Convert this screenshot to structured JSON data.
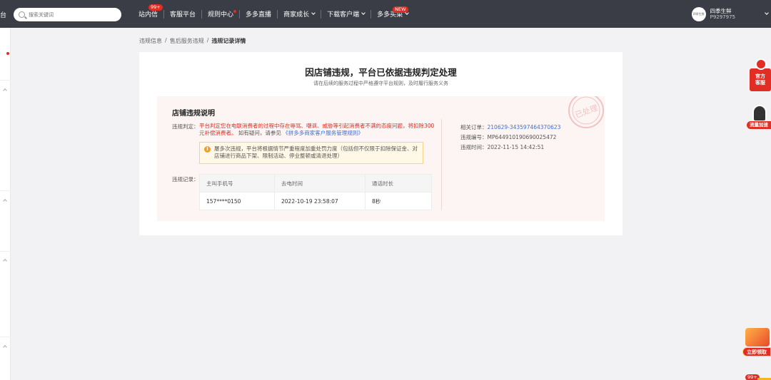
{
  "topbar": {
    "left_cut_text": "台",
    "search_placeholder": "搜索关键词",
    "nav": [
      {
        "label": "站内信",
        "badge": "99+"
      },
      {
        "label": "客服平台"
      },
      {
        "label": "规则中心",
        "dot": true
      },
      {
        "label": "多多直播"
      },
      {
        "label": "商家成长",
        "dropdown": true
      },
      {
        "label": "下载客户端",
        "dropdown": true
      },
      {
        "label": "多多买菜",
        "badge": "NEW",
        "dropdown": true
      }
    ],
    "user": {
      "avatar_text": "四季生鲜",
      "name": "四季生鲜",
      "id": "P9297975"
    }
  },
  "breadcrumb": {
    "items": [
      "违规信息",
      "售后服务违规",
      "违规记录详情"
    ],
    "separator": "/"
  },
  "card": {
    "title": "因店铺违规，平台已依据违规判定处理",
    "subtitle": "请在后续的服务过程中严格遵守平台规则，及时履行服务义务",
    "panel": {
      "title": "店铺违规说明",
      "judgement_label": "违规判定：",
      "judgement_red": "平台判定您在电联消费者的过程中存在辱骂、嘲讽、威胁等引起消费者不满的态度问题，将扣除300元补偿消费者。",
      "judgement_plain": "如有疑问，请参见",
      "judgement_link": "《拼多多商家客户服务管理规则》",
      "notice_icon": "!",
      "notice_text": "屡多次违规，平台将根据情节严重程度加重处罚力度（包括但不仅限于扣除保证金、对店铺进行商品下架、限制活动、停业整顿或清退处理）",
      "record_label": "违规记录：",
      "table": {
        "headers": [
          "主叫手机号",
          "去电时间",
          "通话时长"
        ],
        "rows": [
          [
            "157****0150",
            "2022-10-19 23:58:07",
            "8秒"
          ]
        ]
      },
      "meta": {
        "order_label": "相关订单：",
        "order_value": "210629-343597464370623",
        "violation_no_label": "违规编号：",
        "violation_no_value": "MP644910190690025472",
        "violation_time_label": "违规时间：",
        "violation_time_value": "2022-11-15 14:42:51"
      },
      "stamp_text": "已处理"
    }
  },
  "widgets": {
    "kefu": "官方客服",
    "kefu_line1": "官方",
    "kefu_line2": "客服",
    "liuliang": "流量加速",
    "lingqu": "立即领取",
    "msg_badge": "99+"
  },
  "colors": {
    "topbar_bg": "#3a3d45",
    "accent_red": "#e02e24",
    "link_blue": "#3d6fd9",
    "panel_bg": "#fdf5f4",
    "notice_bg": "#fff8e6"
  }
}
